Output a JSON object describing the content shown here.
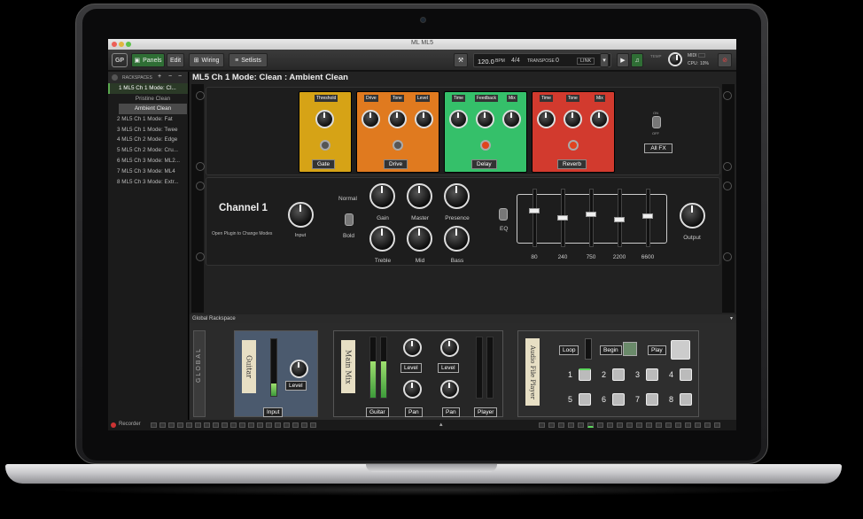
{
  "window": {
    "title": "ML ML5"
  },
  "toolbar": {
    "logo": "GP",
    "panels_label": "Panels",
    "edit_label": "Edit",
    "wiring_label": "Wiring",
    "setlists_label": "Setlists",
    "tempo": "120.0",
    "bpm_label": "BPM",
    "time_signature": "4/4",
    "transpose_label": "TRANSPOSE",
    "transpose_value": "0",
    "link_label": "LINK",
    "tempo_tap_label": "TEMP",
    "midi_label": "MIDI",
    "cpu_label": "CPU:",
    "cpu_value": "10%"
  },
  "sidebar": {
    "header": "RACKSPACES",
    "add_label": "+",
    "remove_label": "−",
    "items": [
      {
        "label": "1  ML5 Ch 1 Mode: Cl..."
      },
      {
        "label": "2  ML5 Ch 1 Mode: Fat"
      },
      {
        "label": "3  ML5 Ch 1 Mode: Twee"
      },
      {
        "label": "4  ML5 Ch 2 Mode: Edge"
      },
      {
        "label": "5  ML5 Ch 2 Mode: Cru..."
      },
      {
        "label": "6  ML5 Ch 3 Mode: ML2..."
      },
      {
        "label": "7  ML5 Ch 3 Mode: ML4"
      },
      {
        "label": "8  ML5 Ch 3 Mode: Extr..."
      }
    ],
    "variations": [
      {
        "label": "Pristine Clean"
      },
      {
        "label": "Ambient Clean"
      }
    ]
  },
  "rackspace": {
    "title": "ML5 Ch 1 Mode: Clean : Ambient Clean",
    "pedals": [
      {
        "name": "Gate",
        "params": [
          "Threshold"
        ],
        "color": "#d6a316"
      },
      {
        "name": "Drive",
        "params": [
          "Drive",
          "Tone",
          "Level"
        ],
        "color": "#e07a1f"
      },
      {
        "name": "Delay",
        "params": [
          "Time",
          "Feedback",
          "Mix"
        ],
        "color": "#35c06a"
      },
      {
        "name": "Reverb",
        "params": [
          "Time",
          "Tone",
          "Mix"
        ],
        "color": "#d23a2e"
      }
    ],
    "fx_switch_on": "ON",
    "fx_switch_off": "OFF",
    "all_fx_label": "All FX"
  },
  "amp": {
    "channel_title": "Channel 1",
    "subtitle": "Open Plugin to Change Modes",
    "input_label": "Input",
    "normal_label": "Normal",
    "bold_label": "Bold",
    "knobs_top": [
      "Gain",
      "Master",
      "Presence"
    ],
    "knobs_bottom": [
      "Treble",
      "Mid",
      "Bass"
    ],
    "eq_label": "EQ",
    "output_label": "Output",
    "eq_bands": [
      "80",
      "240",
      "750",
      "2200",
      "6600"
    ]
  },
  "global": {
    "bar_label": "Global Rackspace",
    "side_label": "GLOBAL",
    "guitar_tape": "Guitar",
    "guitar_level": "Level",
    "guitar_input": "Input",
    "main_mix_tape": "Main Mix",
    "mix_level_1": "Level",
    "mix_level_2": "Level",
    "mix_guitar": "Guitar",
    "mix_pan_1": "Pan",
    "mix_pan_2": "Pan",
    "mix_player": "Player",
    "player_tape": "Audio File Player",
    "loop_label": "Loop",
    "begin_label": "Begin",
    "play_label": "Play",
    "pads": [
      "1",
      "2",
      "3",
      "4",
      "5",
      "6",
      "7",
      "8"
    ]
  },
  "statusbar": {
    "recorder_label": "Recorder"
  },
  "colors": {
    "accent_green": "#2f6e35",
    "selected_bg": "#2b3a27"
  }
}
